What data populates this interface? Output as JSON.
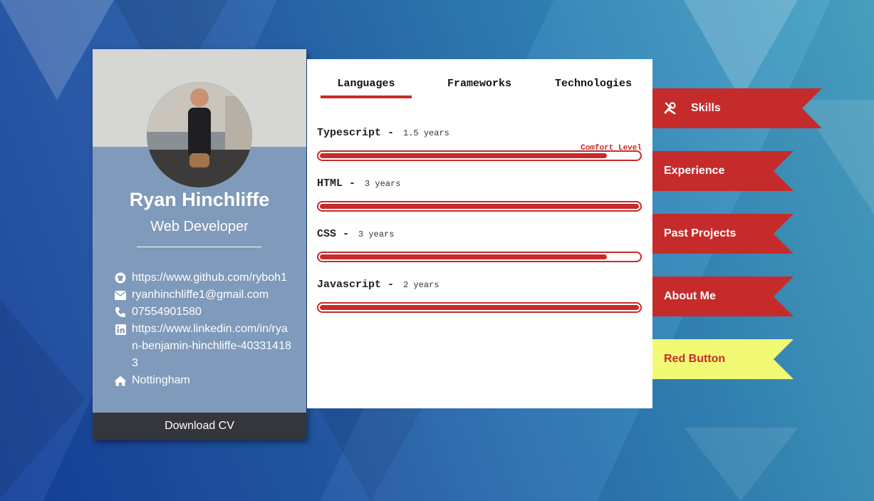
{
  "profile": {
    "name": "Ryan Hinchliffe",
    "role": "Web Developer",
    "contacts": [
      {
        "icon": "github-icon",
        "text": "https://www.github.com/ryboh1"
      },
      {
        "icon": "envelope-icon",
        "text": "ryanhinchliffe1@gmail.com"
      },
      {
        "icon": "phone-icon",
        "text": "07554901580"
      },
      {
        "icon": "linkedin-icon",
        "text": "https://www.linkedin.com/in/ryan-benjamin-hinchliffe-403314183"
      },
      {
        "icon": "home-icon",
        "text": "Nottingham"
      }
    ],
    "download_label": "Download CV"
  },
  "skills": {
    "tabs": [
      "Languages",
      "Frameworks",
      "Technologies"
    ],
    "active_tab": "Languages",
    "comfort_label": "Comfort Level",
    "items": [
      {
        "name": "Typescript",
        "years": "1.5 years",
        "comfort": 0.9
      },
      {
        "name": "HTML",
        "years": "3 years",
        "comfort": 1.0
      },
      {
        "name": "CSS",
        "years": "3 years",
        "comfort": 0.9
      },
      {
        "name": "Javascript",
        "years": "2 years",
        "comfort": 1.0
      }
    ]
  },
  "nav": {
    "items": [
      {
        "label": "Skills",
        "icon": "tools-icon",
        "active": true
      },
      {
        "label": "Experience"
      },
      {
        "label": "Past Projects"
      },
      {
        "label": "About Me"
      },
      {
        "label": "Red Button",
        "highlight": true
      }
    ]
  },
  "colors": {
    "accent": "#c62b2b",
    "highlight": "#f2f974",
    "card": "#7f9aba",
    "card_footer": "#34363b"
  }
}
